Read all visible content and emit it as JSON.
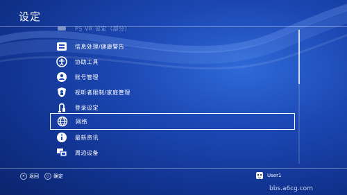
{
  "header": {
    "title": "设定"
  },
  "menu": {
    "items": [
      {
        "label": "PS VR 设定（部分）",
        "icon": "vr-icon"
      },
      {
        "label": "信息处理/健康警告",
        "icon": "info-warning-icon"
      },
      {
        "label": "协助工具",
        "icon": "accessibility-icon"
      },
      {
        "label": "账号管理",
        "icon": "account-icon"
      },
      {
        "label": "视听者限制/家庭管理",
        "icon": "parental-control-icon"
      },
      {
        "label": "登录设定",
        "icon": "login-icon"
      },
      {
        "label": "网络",
        "icon": "network-globe-icon"
      },
      {
        "label": "最新资讯",
        "icon": "info-icon"
      },
      {
        "label": "周边设备",
        "icon": "peripherals-icon"
      }
    ],
    "selected": "网络"
  },
  "footer": {
    "back_label": "返回",
    "confirm_label": "确定",
    "user_label": "User1"
  },
  "watermark": "bbs.a6cg.com",
  "colors": {
    "background": "#1c48b4",
    "accent": "#ffffff"
  }
}
